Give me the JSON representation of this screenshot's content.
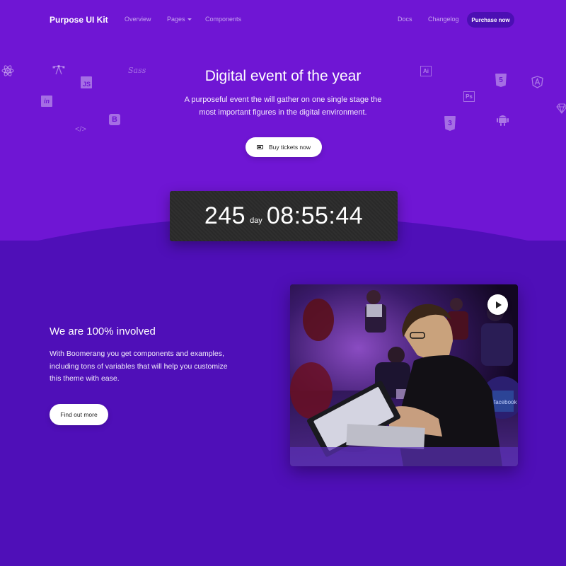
{
  "nav": {
    "brand": "Purpose UI Kit",
    "links": [
      "Overview",
      "Pages",
      "Components"
    ],
    "right_links": [
      "Docs",
      "Changelog"
    ],
    "purchase_label": "Purchase now"
  },
  "hero": {
    "title": "Digital event of the year",
    "subtitle": "A purposeful event the will gather on one single stage the most important figures in the digital environment.",
    "cta_label": "Buy tickets now",
    "cta_icon": "ticket-icon"
  },
  "countdown": {
    "days": "245",
    "day_unit": "day",
    "time": "08:55:44"
  },
  "floating_icons": {
    "react": "react-icon",
    "vector": "vector-pen-icon",
    "js": "JS",
    "sass": "Sass",
    "invision": "in",
    "code": "</>",
    "bootstrap": "B",
    "illustrator": "Ai",
    "html5": "5",
    "angular": "A",
    "photoshop": "Ps",
    "css3": "3",
    "android": "android-icon",
    "sketch": "sketch-icon"
  },
  "about": {
    "title": "We are 100% involved",
    "text": "With Boomerang you get components and examples, including tons of variables that will help you customize this theme with ease.",
    "cta_label": "Find out more"
  },
  "video": {
    "play_icon": "play-icon",
    "laptop_sticker": "facebook"
  },
  "colors": {
    "hero_bg": "#6f16d4",
    "section_bg": "#4f0fb8",
    "button_dark": "#4b0fb3",
    "countdown_bg": "#2b2b2b"
  }
}
